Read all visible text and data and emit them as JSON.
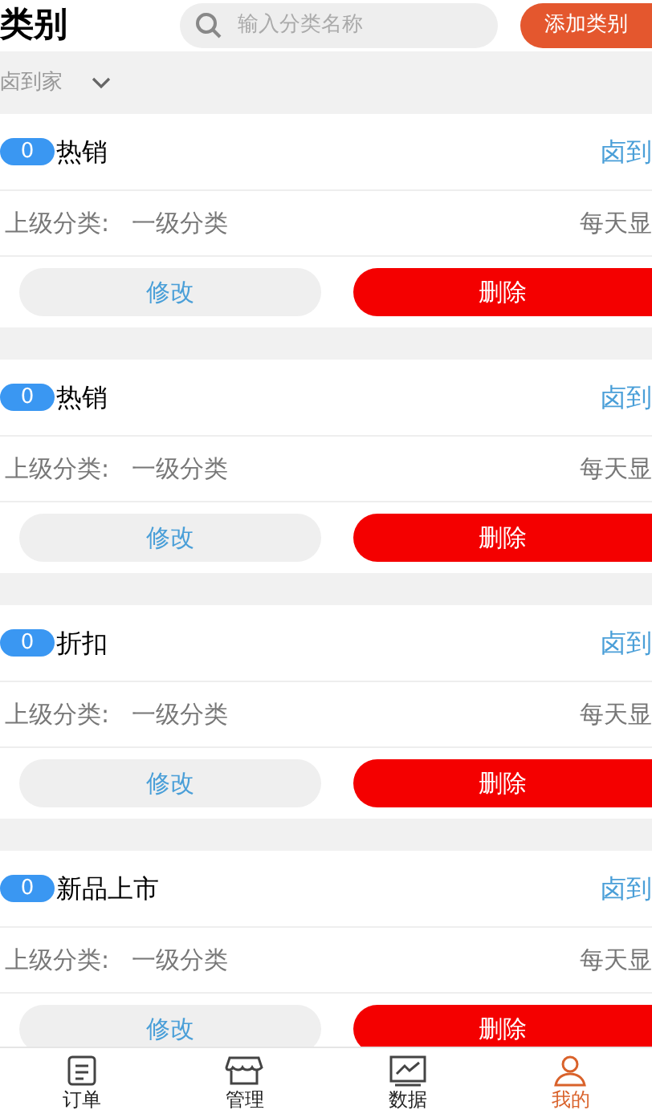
{
  "header": {
    "title": "类别",
    "search": {
      "placeholder": "输入分类名称"
    },
    "add_button": "添加类别"
  },
  "filter": {
    "value": "卤到家"
  },
  "categories": [
    {
      "count": "0",
      "name": "热销",
      "store": "卤到",
      "parent_label": "上级分类:",
      "parent": "一级分类",
      "display": "每天显",
      "edit": "修改",
      "delete": "删除"
    },
    {
      "count": "0",
      "name": "热销",
      "store": "卤到",
      "parent_label": "上级分类:",
      "parent": "一级分类",
      "display": "每天显",
      "edit": "修改",
      "delete": "删除"
    },
    {
      "count": "0",
      "name": "折扣",
      "store": "卤到",
      "parent_label": "上级分类:",
      "parent": "一级分类",
      "display": "每天显",
      "edit": "修改",
      "delete": "删除"
    },
    {
      "count": "0",
      "name": "新品上市",
      "store": "卤到",
      "parent_label": "上级分类:",
      "parent": "一级分类",
      "display": "每天显",
      "edit": "修改",
      "delete": "删除"
    }
  ],
  "tab_bar": [
    {
      "kind": "orders",
      "label": "订单",
      "selected": false
    },
    {
      "kind": "manage",
      "label": "管理",
      "selected": false
    },
    {
      "kind": "data",
      "label": "数据",
      "selected": false
    },
    {
      "kind": "profile",
      "label": "我的",
      "selected": true
    }
  ]
}
